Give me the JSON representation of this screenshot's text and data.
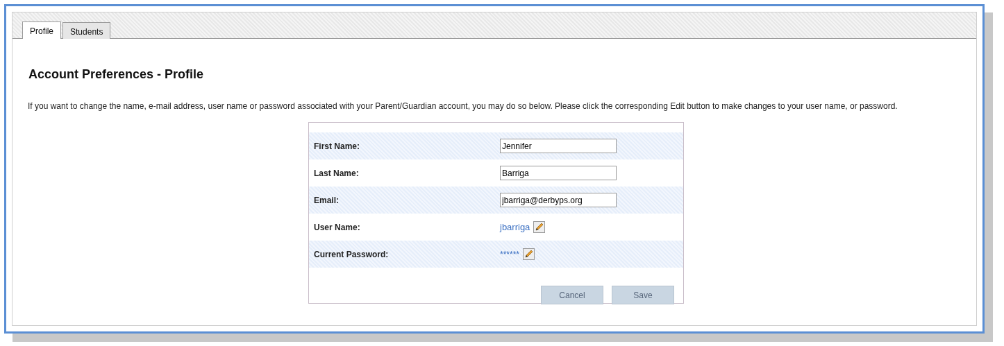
{
  "tabs": [
    {
      "label": "Profile",
      "selected": true
    },
    {
      "label": "Students",
      "selected": false
    }
  ],
  "heading": "Account Preferences - Profile",
  "intro": "If you want to change the name, e-mail address, user name or password associated with your Parent/Guardian account, you may do so below. Please click the corresponding Edit button to make changes to your user name, or password.",
  "fields": [
    {
      "label": "First Name:",
      "kind": "input",
      "value": "Jennifer"
    },
    {
      "label": "Last Name:",
      "kind": "input",
      "value": "Barriga"
    },
    {
      "label": "Email:",
      "kind": "input",
      "value": "jbarriga@derbyps.org"
    },
    {
      "label": "User Name:",
      "kind": "link",
      "value": "jbarriga"
    },
    {
      "label": "Current Password:",
      "kind": "masked",
      "value": "******"
    }
  ],
  "buttons": [
    {
      "label": "Cancel",
      "disabled": true
    },
    {
      "label": "Save",
      "disabled": true
    }
  ]
}
